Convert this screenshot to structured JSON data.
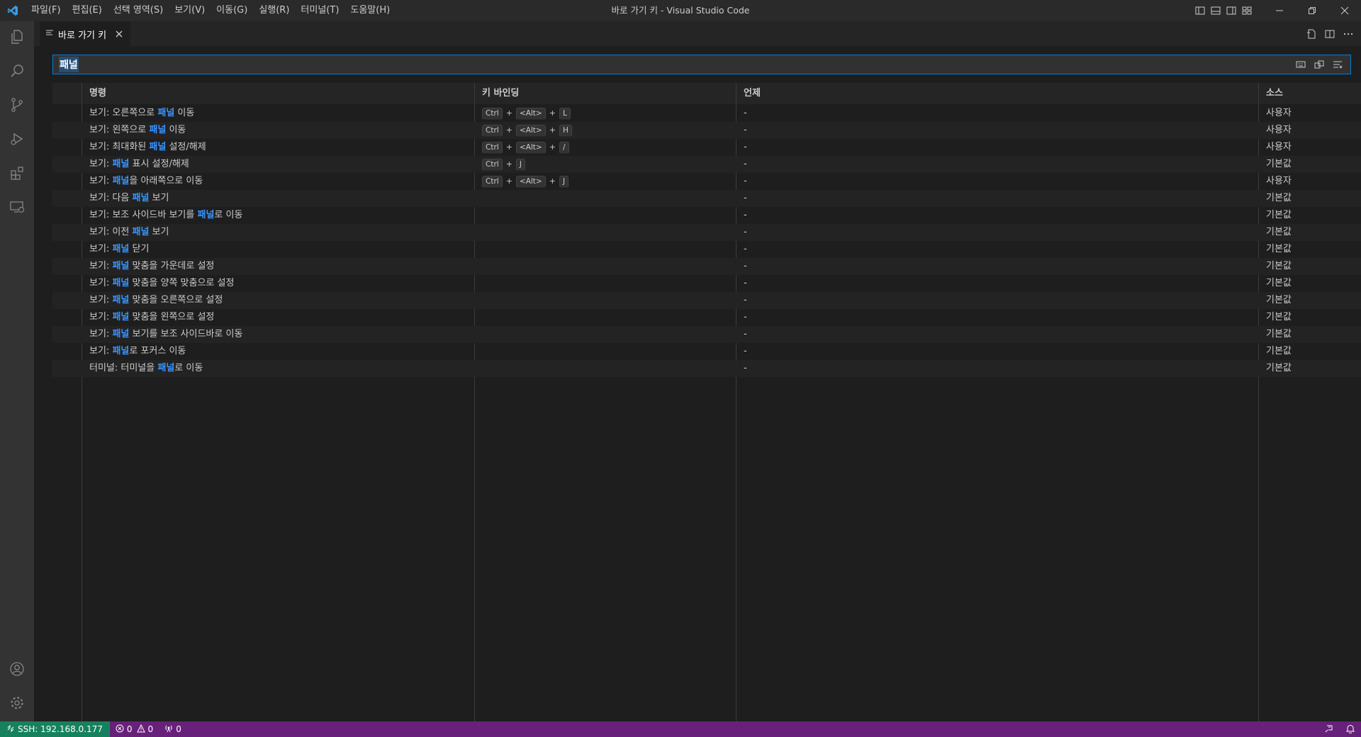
{
  "window": {
    "title": "바로 가기 키 - Visual Studio Code"
  },
  "menu": [
    {
      "label": "파일(F)"
    },
    {
      "label": "편집(E)"
    },
    {
      "label": "선택 영역(S)"
    },
    {
      "label": "보기(V)"
    },
    {
      "label": "이동(G)"
    },
    {
      "label": "실행(R)"
    },
    {
      "label": "터미널(T)"
    },
    {
      "label": "도움말(H)"
    }
  ],
  "activity_icons": [
    "files-icon",
    "search-icon",
    "source-control-icon",
    "run-debug-icon",
    "extensions-icon",
    "remote-explorer-icon"
  ],
  "tab": {
    "label": "바로 가기 키"
  },
  "search": {
    "value": "패널"
  },
  "table": {
    "headers": {
      "command": "명령",
      "keybinding": "키 바인딩",
      "when": "언제",
      "source": "소스"
    },
    "rows": [
      {
        "prefix": "보기: 오른쪽으로 ",
        "match": "패널",
        "suffix": " 이동",
        "keys": [
          "Ctrl",
          "<Alt>",
          "L"
        ],
        "when": "-",
        "source": "사용자"
      },
      {
        "prefix": "보기: 왼쪽으로 ",
        "match": "패널",
        "suffix": " 이동",
        "keys": [
          "Ctrl",
          "<Alt>",
          "H"
        ],
        "when": "-",
        "source": "사용자"
      },
      {
        "prefix": "보기: 최대화된 ",
        "match": "패널",
        "suffix": " 설정/해제",
        "keys": [
          "Ctrl",
          "<Alt>",
          "/"
        ],
        "when": "-",
        "source": "사용자"
      },
      {
        "prefix": "보기: ",
        "match": "패널",
        "suffix": " 표시 설정/해제",
        "keys": [
          "Ctrl",
          "J"
        ],
        "when": "-",
        "source": "기본값"
      },
      {
        "prefix": "보기: ",
        "match": "패널",
        "suffix": "을 아래쪽으로 이동",
        "keys": [
          "Ctrl",
          "<Alt>",
          "J"
        ],
        "when": "-",
        "source": "사용자"
      },
      {
        "prefix": "보기: 다음 ",
        "match": "패널",
        "suffix": " 보기",
        "keys": [],
        "when": "-",
        "source": "기본값"
      },
      {
        "prefix": "보기: 보조 사이드바 보기를 ",
        "match": "패널",
        "suffix": "로 이동",
        "keys": [],
        "when": "-",
        "source": "기본값"
      },
      {
        "prefix": "보기: 이전 ",
        "match": "패널",
        "suffix": " 보기",
        "keys": [],
        "when": "-",
        "source": "기본값"
      },
      {
        "prefix": "보기: ",
        "match": "패널",
        "suffix": " 닫기",
        "keys": [],
        "when": "-",
        "source": "기본값"
      },
      {
        "prefix": "보기: ",
        "match": "패널",
        "suffix": " 맞춤을 가운데로 설정",
        "keys": [],
        "when": "-",
        "source": "기본값"
      },
      {
        "prefix": "보기: ",
        "match": "패널",
        "suffix": " 맞춤을 양쪽 맞춤으로 설정",
        "keys": [],
        "when": "-",
        "source": "기본값"
      },
      {
        "prefix": "보기: ",
        "match": "패널",
        "suffix": " 맞춤을 오른쪽으로 설정",
        "keys": [],
        "when": "-",
        "source": "기본값"
      },
      {
        "prefix": "보기: ",
        "match": "패널",
        "suffix": " 맞춤을 왼쪽으로 설정",
        "keys": [],
        "when": "-",
        "source": "기본값"
      },
      {
        "prefix": "보기: ",
        "match": "패널",
        "suffix": " 보기를 보조 사이드바로 이동",
        "keys": [],
        "when": "-",
        "source": "기본값"
      },
      {
        "prefix": "보기: ",
        "match": "패널",
        "suffix": "로 포커스 이동",
        "keys": [],
        "when": "-",
        "source": "기본값"
      },
      {
        "prefix": "터미널: 터미널을 ",
        "match": "패널",
        "suffix": "로 이동",
        "keys": [],
        "when": "-",
        "source": "기본값"
      }
    ]
  },
  "status": {
    "remote": "SSH: 192.168.0.177",
    "errors": "0",
    "warnings": "0",
    "ports": "0"
  },
  "colors": {
    "accent": "#007fd4",
    "match_highlight": "#3794ff",
    "status_bar": "#68217a",
    "remote_indicator": "#16825d"
  }
}
